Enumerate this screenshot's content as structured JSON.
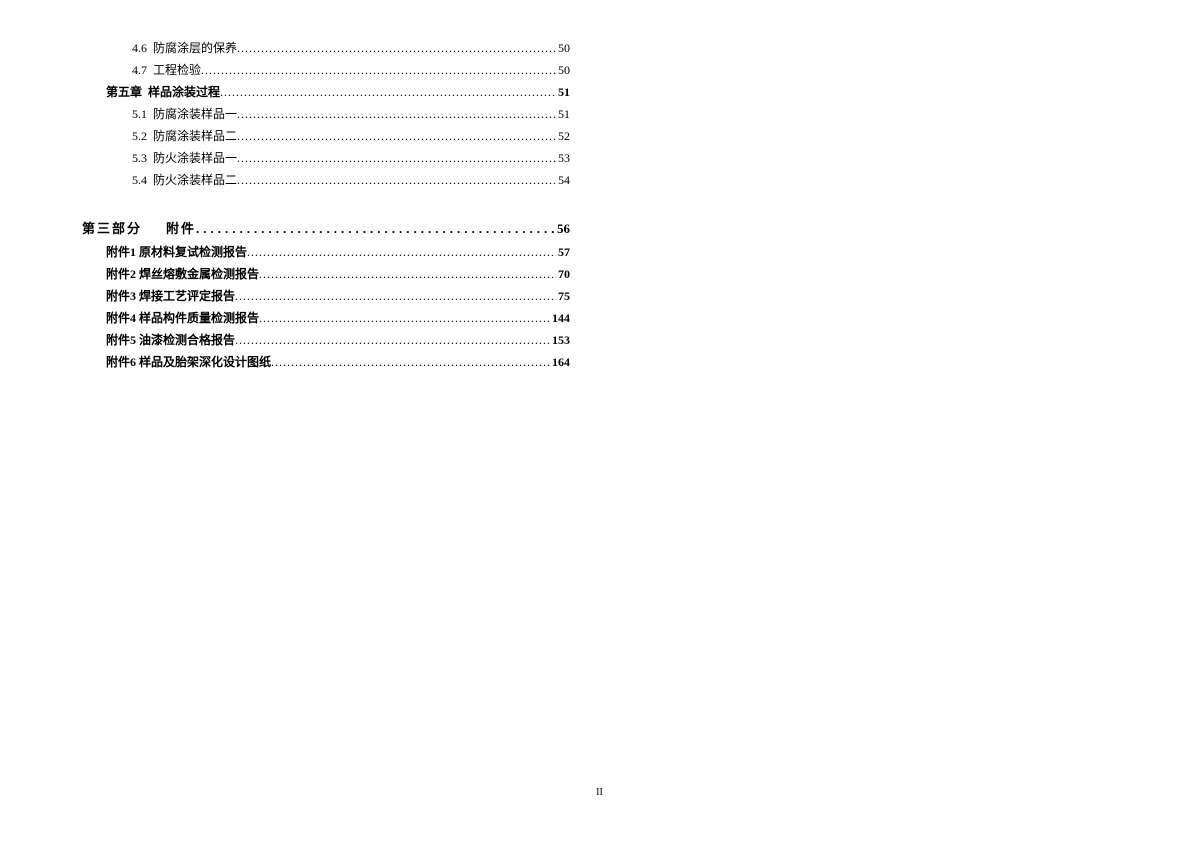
{
  "sections": [
    {
      "type": "entry",
      "indent": 2,
      "num": "4.6",
      "title": "防腐涂层的保养",
      "page": "50",
      "bold": false
    },
    {
      "type": "entry",
      "indent": 2,
      "num": "4.7",
      "title": "工程检验",
      "page": "50",
      "bold": false
    },
    {
      "type": "entry",
      "indent": 1,
      "num": "第五章",
      "title": "样品涂装过程",
      "page": "51",
      "bold": true
    },
    {
      "type": "entry",
      "indent": 2,
      "num": "5.1",
      "title": "防腐涂装样品一",
      "page": "51",
      "bold": false
    },
    {
      "type": "entry",
      "indent": 2,
      "num": "5.2",
      "title": "防腐涂装样品二",
      "page": "52",
      "bold": false
    },
    {
      "type": "entry",
      "indent": 2,
      "num": "5.3",
      "title": "防火涂装样品一",
      "page": "53",
      "bold": false
    },
    {
      "type": "entry",
      "indent": 2,
      "num": "5.4",
      "title": "防火涂装样品二",
      "page": "54",
      "bold": false
    }
  ],
  "part3": {
    "label": "第三部分",
    "title": "附件",
    "page": "56"
  },
  "appendices": [
    {
      "num": "附件1",
      "title": "原材料复试检测报告",
      "page": "57"
    },
    {
      "num": "附件2",
      "title": "焊丝熔敷金属检测报告",
      "page": "70"
    },
    {
      "num": "附件3",
      "title": "焊接工艺评定报告",
      "page": "75"
    },
    {
      "num": "附件4",
      "title": "样品构件质量检测报告",
      "page": "144"
    },
    {
      "num": "附件5",
      "title": "油漆检测合格报告",
      "page": "153"
    },
    {
      "num": "附件6",
      "title": "样品及胎架深化设计图纸",
      "page": "164"
    }
  ],
  "footer": "II"
}
